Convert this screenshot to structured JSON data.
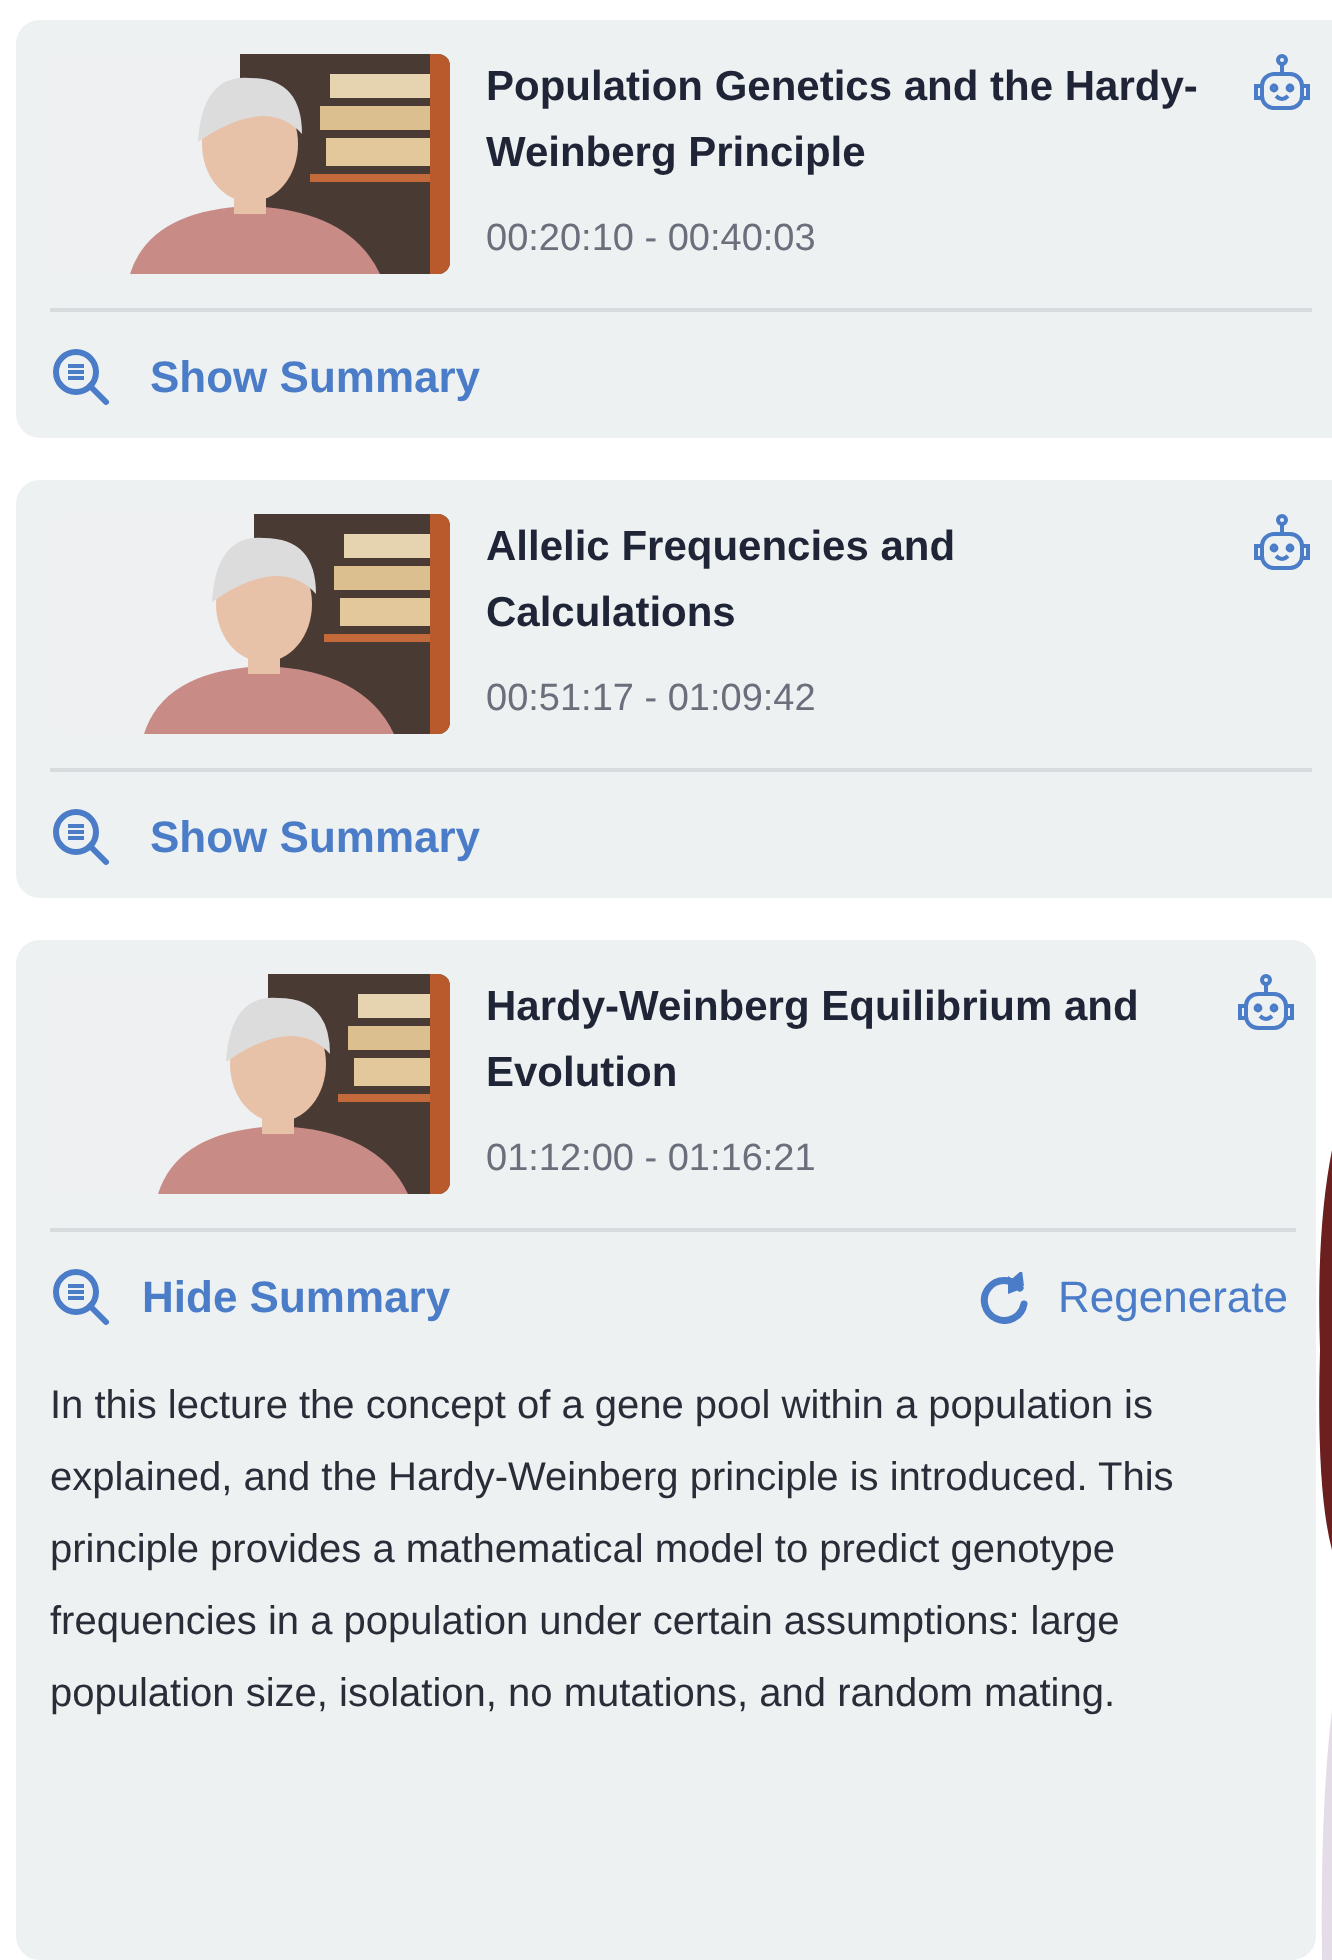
{
  "segments": [
    {
      "title": "Population Genetics and the Hardy-Weinberg Principle",
      "time_range": "00:20:10 - 00:40:03",
      "summary_toggle": "Show Summary",
      "expanded": false
    },
    {
      "title": "Allelic Frequencies and Calculations",
      "time_range": "00:51:17 - 01:09:42",
      "summary_toggle": "Show Summary",
      "expanded": false
    },
    {
      "title": "Hardy-Weinberg Equilibrium and Evolution",
      "time_range": "01:12:00 - 01:16:21",
      "summary_toggle": "Hide Summary",
      "expanded": true,
      "regenerate": "Regenerate",
      "summary": "In this lecture the concept of a gene pool within a population is explained, and the Hardy-Weinberg principle is introduced. This principle provides a mathematical model to predict genotype frequencies in a population under certain assumptions: large population size, isolation, no mutations, and random mating."
    }
  ]
}
